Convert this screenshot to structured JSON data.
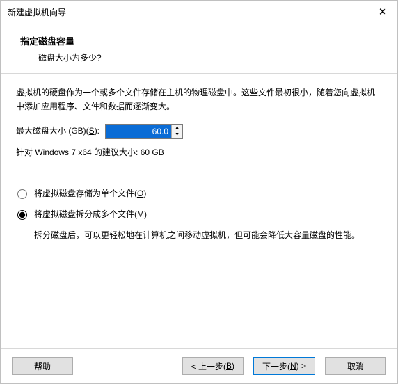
{
  "window": {
    "title": "新建虚拟机向导"
  },
  "header": {
    "heading": "指定磁盘容量",
    "subheading": "磁盘大小为多少?"
  },
  "desc": "虚拟机的硬盘作为一个或多个文件存储在主机的物理磁盘中。这些文件最初很小，随着您向虚拟机中添加应用程序、文件和数据而逐渐变大。",
  "size": {
    "label_prefix": "最大磁盘大小 (GB)(",
    "label_hotkey": "S",
    "label_suffix": "):",
    "value": "60.0"
  },
  "recommended": "针对 Windows 7 x64 的建议大小: 60 GB",
  "radios": {
    "single": {
      "label_prefix": "将虚拟磁盘存储为单个文件(",
      "hotkey": "O",
      "label_suffix": ")",
      "checked": false
    },
    "split": {
      "label_prefix": "将虚拟磁盘拆分成多个文件(",
      "hotkey": "M",
      "label_suffix": ")",
      "checked": true,
      "note": "拆分磁盘后，可以更轻松地在计算机之间移动虚拟机，但可能会降低大容量磁盘的性能。"
    }
  },
  "footer": {
    "help": "帮助",
    "back_prefix": "< 上一步(",
    "back_hotkey": "B",
    "back_suffix": ")",
    "next_prefix": "下一步(",
    "next_hotkey": "N",
    "next_suffix": ") >",
    "cancel": "取消"
  }
}
